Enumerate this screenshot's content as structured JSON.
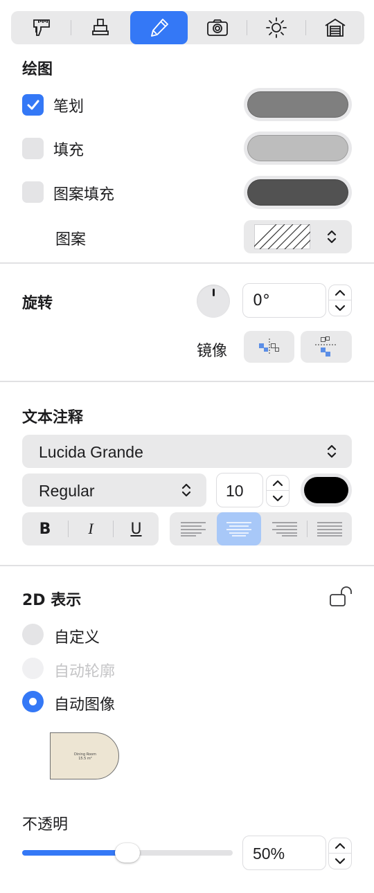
{
  "toolbar": {
    "tools": [
      {
        "name": "caliper-icon",
        "active": false
      },
      {
        "name": "stamp-icon",
        "active": false
      },
      {
        "name": "pencil-icon",
        "active": true
      },
      {
        "name": "camera-icon",
        "active": false
      },
      {
        "name": "sun-icon",
        "active": false
      },
      {
        "name": "house-icon",
        "active": false
      }
    ]
  },
  "drawing": {
    "title": "绘图",
    "stroke_label": "笔划",
    "fill_label": "填充",
    "pattern_fill_label": "图案填充",
    "pattern_label": "图案",
    "stroke_checked": true,
    "fill_checked": false,
    "pattern_fill_checked": false,
    "stroke_color": "#7f7f7f",
    "fill_color": "#bdbdbd",
    "pattern_fill_color": "#525252"
  },
  "rotation": {
    "title": "旋转",
    "value": "0°",
    "mirror_label": "镜像"
  },
  "text_annotation": {
    "title": "文本注释",
    "font_family": "Lucida Grande",
    "font_style": "Regular",
    "font_size": "10",
    "text_color": "#000000",
    "bold": "B",
    "italic": "I",
    "underline": "U",
    "alignment_selected": "center"
  },
  "display_2d": {
    "title": "2D 表示",
    "options": [
      {
        "label": "自定义",
        "state": "off"
      },
      {
        "label": "自动轮廓",
        "state": "disabled"
      },
      {
        "label": "自动图像",
        "state": "on"
      }
    ],
    "preview_text_1": "Dining Room",
    "preview_text_2": "15.5 m²"
  },
  "opacity": {
    "title": "不透明",
    "value_text": "50%",
    "value": 0.5
  },
  "colors": {
    "accent": "#3478f6",
    "selected_align_bg": "#a8c8f8"
  }
}
